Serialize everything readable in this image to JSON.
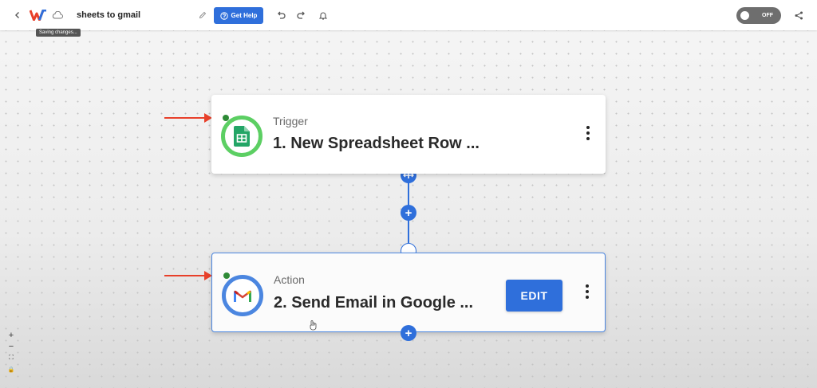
{
  "topbar": {
    "back_icon": "chevron-left-icon",
    "logo_icon": "w-logo-icon",
    "cloud_icon": "cloud-icon",
    "title": "sheets to gmail",
    "saving_tooltip": "Saving changes...",
    "help_label": "Get Help",
    "undo_icon": "undo-icon",
    "redo_icon": "redo-icon",
    "bell_icon": "bell-icon",
    "toggle_label": "OFF",
    "share_icon": "share-icon"
  },
  "steps": [
    {
      "kind_label": "Trigger",
      "title": "1. New Spreadsheet Row ...",
      "icon": "google-sheets-icon",
      "status_color": "#2e8a36"
    },
    {
      "kind_label": "Action",
      "title": "2. Send Email in Google ...",
      "icon": "gmail-icon",
      "status_color": "#2e8a36",
      "edit_label": "EDIT"
    }
  ],
  "zoom_controls": [
    "+",
    "−",
    "⛶",
    "🔒"
  ],
  "colors": {
    "accent": "#2f6fdb",
    "trigger_ring": "#5ccf63",
    "action_ring": "#4b86e0",
    "annotation_arrow": "#e8402a"
  }
}
